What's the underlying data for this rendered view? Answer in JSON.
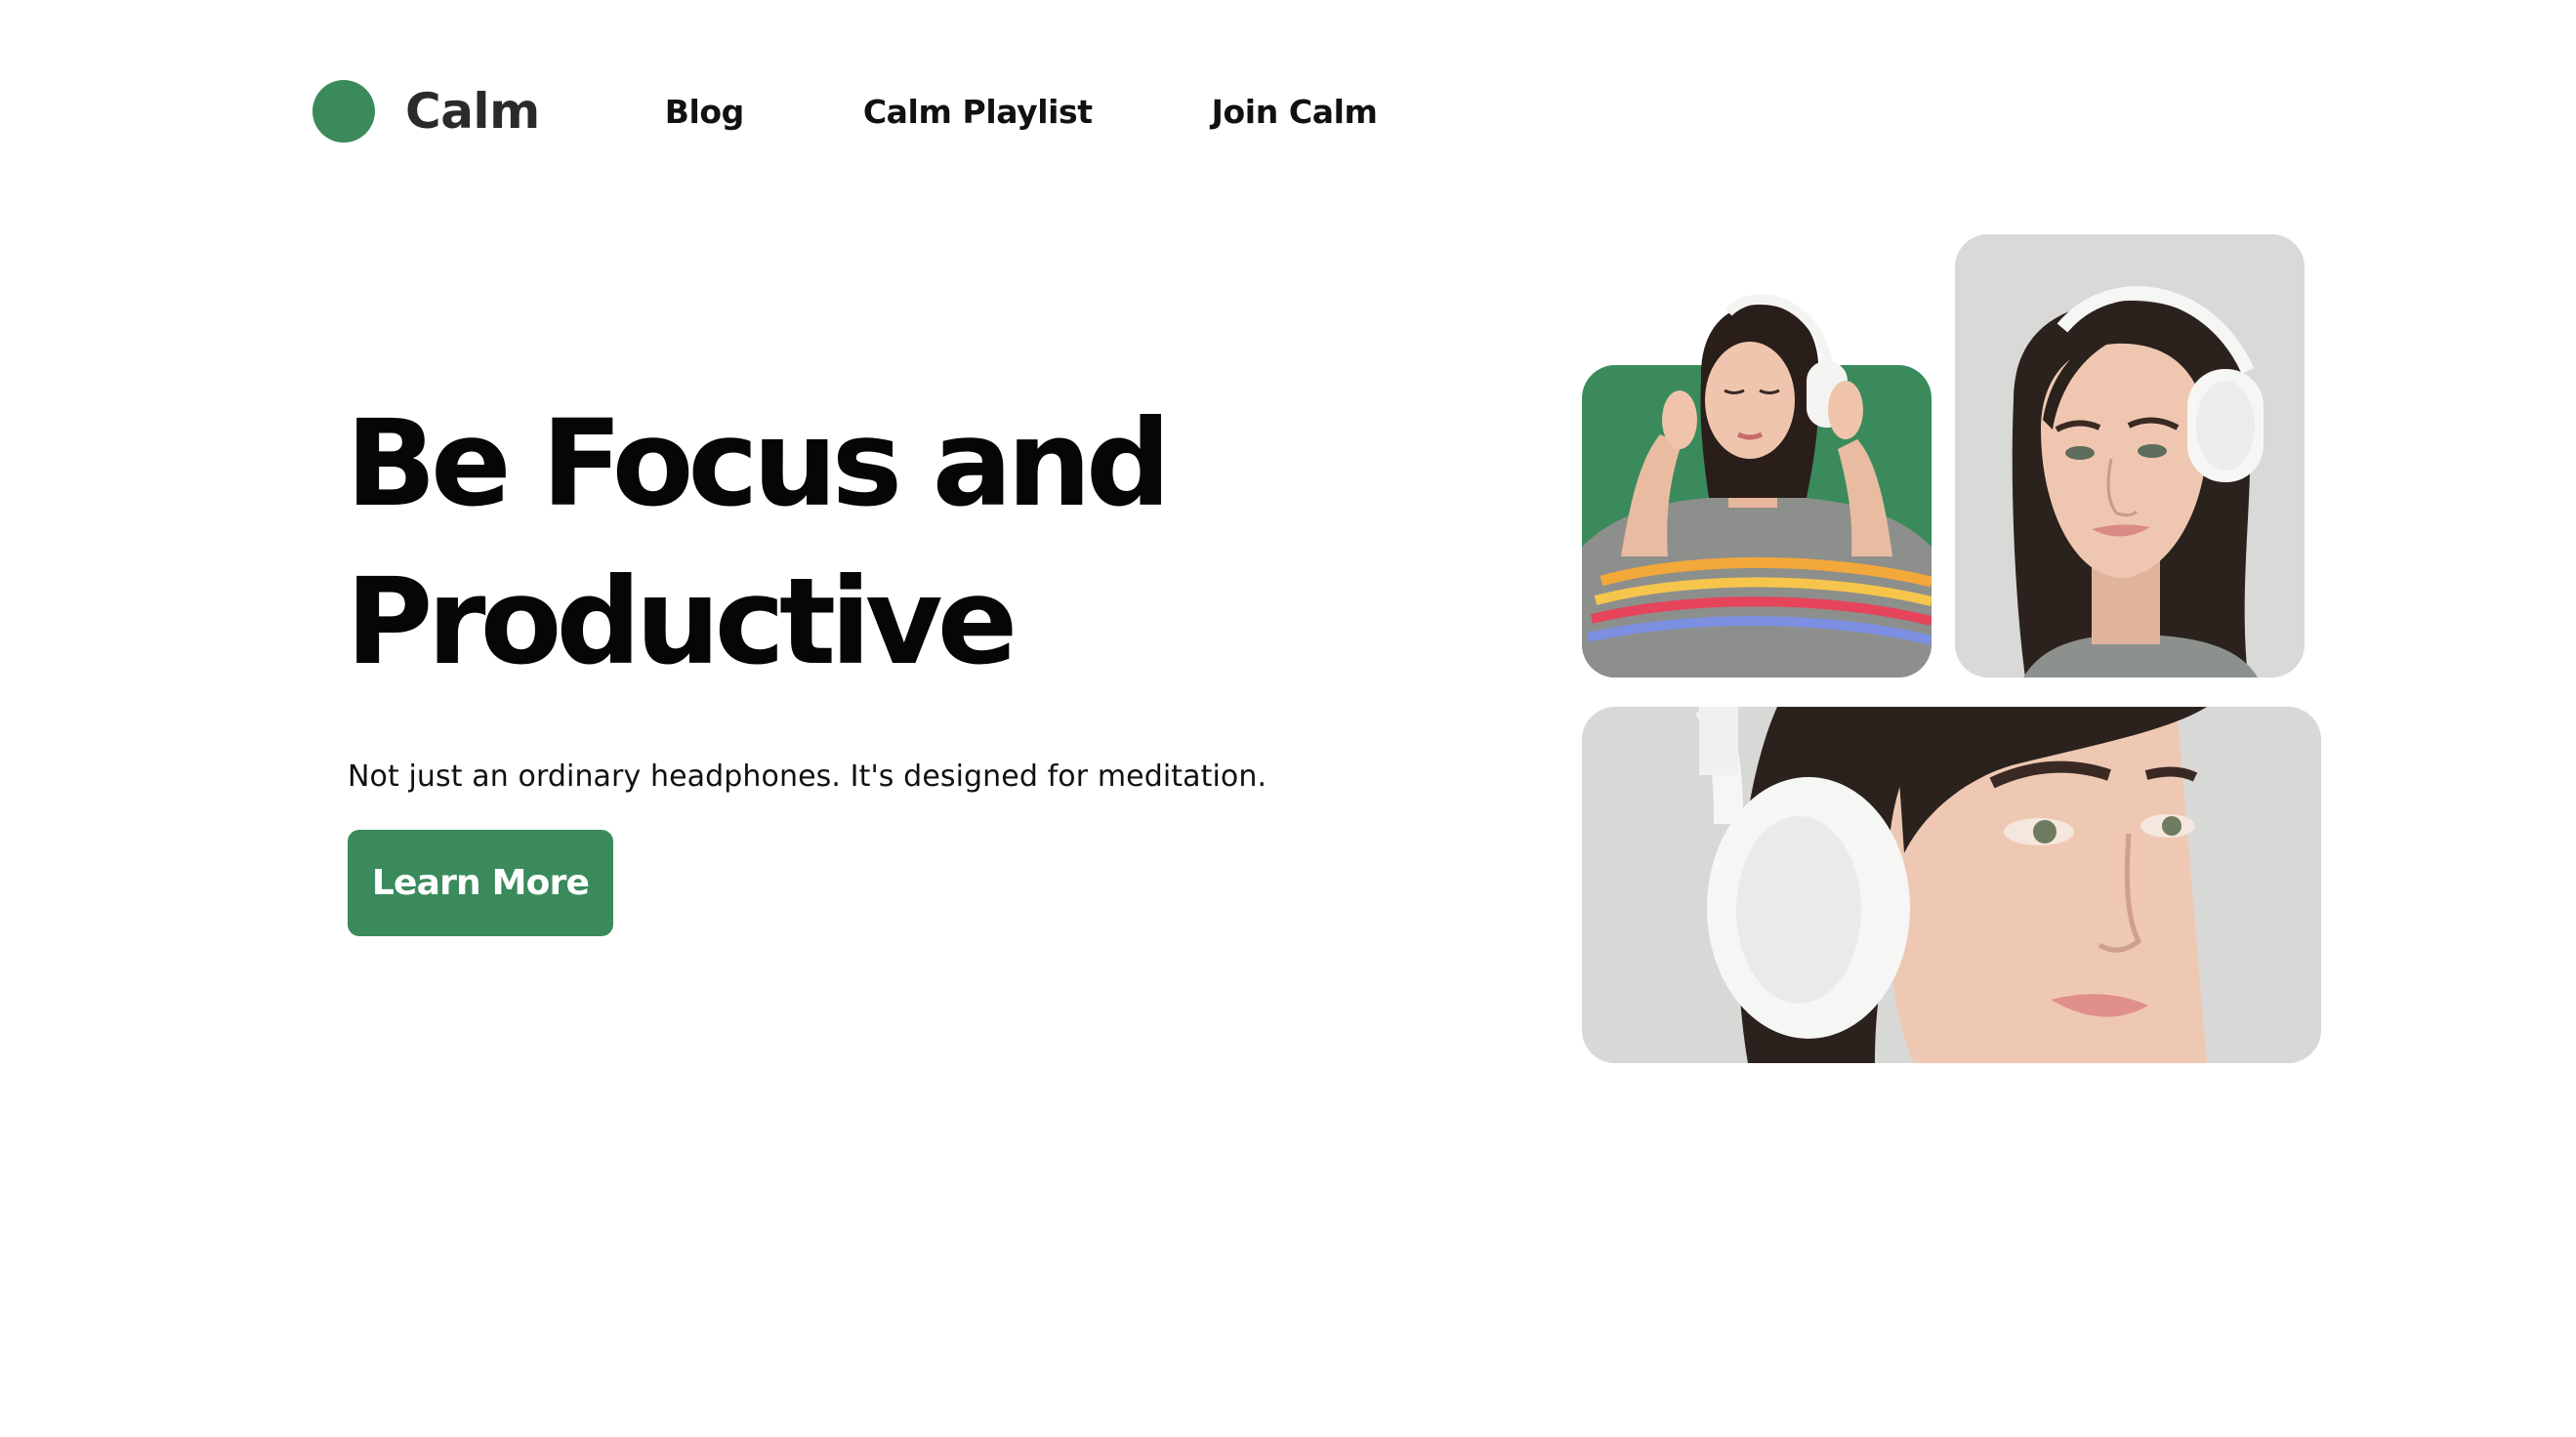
{
  "brand": {
    "name": "Calm",
    "color": "#3a8a5c",
    "logo_icon": "circle-logo-icon"
  },
  "nav": {
    "links": [
      {
        "label": "Blog"
      },
      {
        "label": "Calm Playlist"
      },
      {
        "label": "Join Calm"
      }
    ]
  },
  "hero": {
    "title_line1": "Be Focus and",
    "title_line2": "Productive",
    "subtitle": "Not just an ordinary headphones. It's designed for meditation.",
    "cta_label": "Learn More"
  },
  "gallery": {
    "images": [
      {
        "name": "woman-adjusting-headphones-photo",
        "background": "#3a8a5c"
      },
      {
        "name": "woman-with-headphones-portrait-photo",
        "background": "#d9d9d7"
      },
      {
        "name": "woman-with-headphones-closeup-photo",
        "background": "#d8d8d6"
      }
    ]
  }
}
